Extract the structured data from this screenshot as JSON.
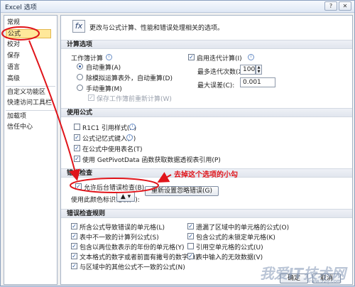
{
  "window": {
    "title": "Excel 选项"
  },
  "sidebar": {
    "items": [
      {
        "label": "常规"
      },
      {
        "label": "公式",
        "selected": true
      },
      {
        "label": "校对"
      },
      {
        "label": "保存"
      },
      {
        "label": "语言"
      },
      {
        "label": "高级"
      },
      {
        "label": "自定义功能区"
      },
      {
        "label": "快速访问工具栏"
      },
      {
        "label": "加载项"
      },
      {
        "label": "信任中心"
      }
    ]
  },
  "header": {
    "text": "更改与公式计算、性能和错误处理相关的选项。"
  },
  "calc": {
    "section": "计算选项",
    "workbook_calc_label": "工作簿计算",
    "auto": "自动重算(A)",
    "auto_except_tables": "除模拟运算表外，自动重算(D)",
    "manual": "手动重算(M)",
    "recalc_before_save": "保存工作簿前重新计算(W)",
    "iterative": "启用迭代计算(I)",
    "max_iter_label": "最多迭代次数(X):",
    "max_iter_value": "100",
    "max_change_label": "最大误差(C):",
    "max_change_value": "0.001"
  },
  "formulas": {
    "section": "使用公式",
    "items": [
      {
        "label": "R1C1 引用样式(R)",
        "checked": false
      },
      {
        "label": "公式记忆式键入(F)",
        "checked": true
      },
      {
        "label": "在公式中使用表名(T)",
        "checked": true
      },
      {
        "label": "使用 GetPivotData 函数获取数据透视表引用(P)",
        "checked": true
      }
    ]
  },
  "error_check": {
    "section": "错误检查",
    "enable_bg": "允许后台错误检查(B)",
    "color_label": "使用此颜色标识错误(E):",
    "reset_button": "重新设置忽略错误(G)"
  },
  "annotation": "去掉这个选项的小勾",
  "rules": {
    "section": "错误检查规则",
    "left": [
      "所含公式导致错误的单元格(L)",
      "表中不一致的计算列公式(S)",
      "包含以两位数表示的年份的单元格(Y)",
      "文本格式的数字或者前面有撇号的数字(H)",
      "与区域中的其他公式不一致的公式(N)"
    ],
    "right": [
      "遗漏了区域中的单元格的公式(O)",
      "包含公式的未锁定单元格(K)",
      "引用空单元格的公式(U)",
      "表中输入的无效数据(V)"
    ],
    "right_checked": [
      true,
      true,
      false,
      true
    ]
  },
  "footer": {
    "ok": "确定",
    "cancel": "取消"
  },
  "watermark": {
    "text": "我爱IT技术网",
    "url": "www.52ij.com"
  },
  "colors": {
    "annotation": "#e0141a",
    "selected_bg": "#ffe89a"
  }
}
